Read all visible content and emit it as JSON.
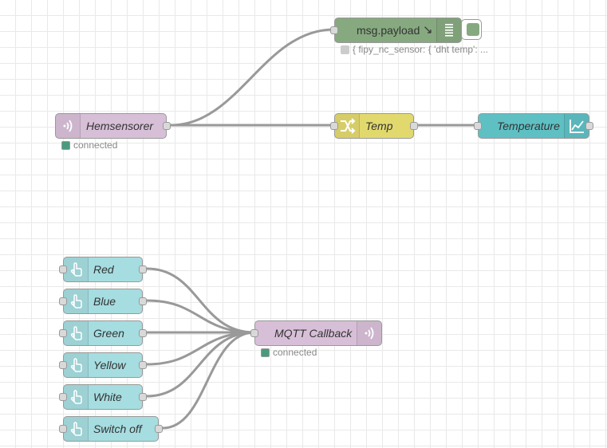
{
  "colors": {
    "mqtt_node": "#d8bfd8",
    "debug_node": "#87a980",
    "function_node": "#e2d96e",
    "chart_node": "#5fc0c4",
    "inject_node": "#a6dde0",
    "status_green": "#4a9b7d",
    "status_grey": "#cccccc",
    "wire": "#999999",
    "grid": "#e9e9e9"
  },
  "nodes": {
    "hemsensorer": {
      "label": "Hemsensorer",
      "icon": "mqtt-wave-icon",
      "status": "connected"
    },
    "debug": {
      "label": "msg.payload",
      "icon": "debug-list-icon",
      "status": "{ fipy_nc_sensor: { 'dht temp': ..."
    },
    "temp": {
      "label": "Temp",
      "icon": "shuffle-icon"
    },
    "temperature": {
      "label": "Temperature",
      "icon": "chart-icon"
    },
    "mqtt_callback": {
      "label": "MQTT Callback",
      "icon": "mqtt-wave-icon",
      "status": "connected"
    }
  },
  "inject_buttons": [
    {
      "label": "Red"
    },
    {
      "label": "Blue"
    },
    {
      "label": "Green"
    },
    {
      "label": "Yellow"
    },
    {
      "label": "White"
    },
    {
      "label": "Switch off"
    }
  ]
}
